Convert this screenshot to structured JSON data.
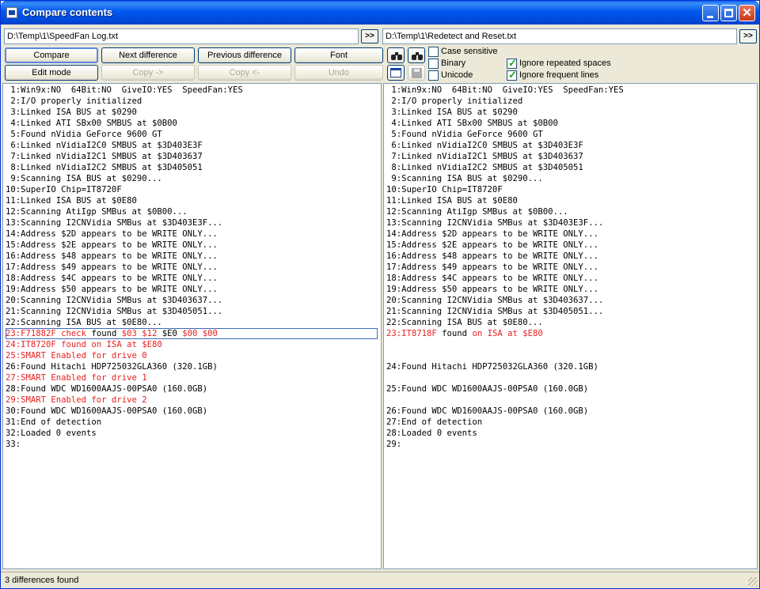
{
  "window": {
    "title": "Compare contents",
    "close_glyph": "✕"
  },
  "files": {
    "left_path": "D:\\Temp\\1\\SpeedFan Log.txt",
    "right_path": "D:\\Temp\\1\\Redetect and Reset.txt",
    "browse_label": ">>"
  },
  "toolbar": {
    "compare": "Compare",
    "next_difference": "Next difference",
    "previous_difference": "Previous difference",
    "font": "Font",
    "edit_mode": "Edit mode",
    "copy_right": "Copy ->",
    "copy_left": "Copy <-",
    "undo": "Undo"
  },
  "options": {
    "case_sensitive": {
      "label": "Case sensitive",
      "checked": false
    },
    "binary": {
      "label": "Binary",
      "checked": false
    },
    "unicode": {
      "label": "Unicode",
      "checked": false
    },
    "ignore_repeated_spaces": {
      "label": "Ignore repeated spaces",
      "checked": true
    },
    "ignore_frequent_lines": {
      "label": "Ignore frequent lines",
      "checked": true
    }
  },
  "icons": {
    "find": "binoculars-icon",
    "find_next": "binoculars-icon",
    "window": "window-icon",
    "save": "save-icon"
  },
  "colors": {
    "difference": "#e82020",
    "focus_outline": "#3c6bba"
  },
  "left_lines": [
    [
      {
        "t": " 1:Win9x:NO  64Bit:NO  GiveIO:YES  SpeedFan:YES"
      }
    ],
    [
      {
        "t": " 2:I/O properly initialized"
      }
    ],
    [
      {
        "t": " 3:Linked ISA BUS at $0290"
      }
    ],
    [
      {
        "t": " 4:Linked ATI SBx00 SMBUS at $0B00"
      }
    ],
    [
      {
        "t": " 5:Found nVidia GeForce 9600 GT"
      }
    ],
    [
      {
        "t": " 6:Linked nVidiaI2C0 SMBUS at $3D403E3F"
      }
    ],
    [
      {
        "t": " 7:Linked nVidiaI2C1 SMBUS at $3D403637"
      }
    ],
    [
      {
        "t": " 8:Linked nVidiaI2C2 SMBUS at $3D405051"
      }
    ],
    [
      {
        "t": " 9:Scanning ISA BUS at $0290..."
      }
    ],
    [
      {
        "t": "10:SuperIO Chip=IT8720F"
      }
    ],
    [
      {
        "t": "11:Linked ISA BUS at $0E80"
      }
    ],
    [
      {
        "t": "12:Scanning AtiIgp SMBus at $0B00..."
      }
    ],
    [
      {
        "t": "13:Scanning I2CNVidia SMBus at $3D403E3F..."
      }
    ],
    [
      {
        "t": "14:Address $2D appears to be WRITE ONLY..."
      }
    ],
    [
      {
        "t": "15:Address $2E appears to be WRITE ONLY..."
      }
    ],
    [
      {
        "t": "16:Address $48 appears to be WRITE ONLY..."
      }
    ],
    [
      {
        "t": "17:Address $49 appears to be WRITE ONLY..."
      }
    ],
    [
      {
        "t": "18:Address $4C appears to be WRITE ONLY..."
      }
    ],
    [
      {
        "t": "19:Address $50 appears to be WRITE ONLY..."
      }
    ],
    [
      {
        "t": "20:Scanning I2CNVidia SMBus at $3D403637..."
      }
    ],
    [
      {
        "t": "21:Scanning I2CNVidia SMBus at $3D405051..."
      }
    ],
    [
      {
        "t": "22:Scanning ISA BUS at $0E80..."
      }
    ],
    [
      {
        "t": "23:F71882F check",
        "d": true
      },
      {
        "t": " found "
      },
      {
        "t": "$03 $12",
        "d": true
      },
      {
        "t": " $E0 "
      },
      {
        "t": "$00 $00",
        "d": true
      }
    ],
    [
      {
        "t": "24:IT8720F found on ISA at $E80",
        "d": true
      }
    ],
    [
      {
        "t": "25:SMART Enabled for drive 0",
        "d": true
      }
    ],
    [
      {
        "t": "26:Found Hitachi HDP725032GLA360 (320.1GB)"
      }
    ],
    [
      {
        "t": "27:SMART Enabled for drive 1",
        "d": true
      }
    ],
    [
      {
        "t": "28:Found WDC WD1600AAJS-00PSA0 (160.0GB)"
      }
    ],
    [
      {
        "t": "29:SMART Enabled for drive 2",
        "d": true
      }
    ],
    [
      {
        "t": "30:Found WDC WD1600AAJS-00PSA0 (160.0GB)"
      }
    ],
    [
      {
        "t": "31:End of detection"
      }
    ],
    [
      {
        "t": "32:Loaded 0 events"
      }
    ],
    [
      {
        "t": "33:"
      }
    ]
  ],
  "right_lines": [
    [
      {
        "t": " 1:Win9x:NO  64Bit:NO  GiveIO:YES  SpeedFan:YES"
      }
    ],
    [
      {
        "t": " 2:I/O properly initialized"
      }
    ],
    [
      {
        "t": " 3:Linked ISA BUS at $0290"
      }
    ],
    [
      {
        "t": " 4:Linked ATI SBx00 SMBUS at $0B00"
      }
    ],
    [
      {
        "t": " 5:Found nVidia GeForce 9600 GT"
      }
    ],
    [
      {
        "t": " 6:Linked nVidiaI2C0 SMBUS at $3D403E3F"
      }
    ],
    [
      {
        "t": " 7:Linked nVidiaI2C1 SMBUS at $3D403637"
      }
    ],
    [
      {
        "t": " 8:Linked nVidiaI2C2 SMBUS at $3D405051"
      }
    ],
    [
      {
        "t": " 9:Scanning ISA BUS at $0290..."
      }
    ],
    [
      {
        "t": "10:SuperIO Chip=IT8720F"
      }
    ],
    [
      {
        "t": "11:Linked ISA BUS at $0E80"
      }
    ],
    [
      {
        "t": "12:Scanning AtiIgp SMBus at $0B00..."
      }
    ],
    [
      {
        "t": "13:Scanning I2CNVidia SMBus at $3D403E3F..."
      }
    ],
    [
      {
        "t": "14:Address $2D appears to be WRITE ONLY..."
      }
    ],
    [
      {
        "t": "15:Address $2E appears to be WRITE ONLY..."
      }
    ],
    [
      {
        "t": "16:Address $48 appears to be WRITE ONLY..."
      }
    ],
    [
      {
        "t": "17:Address $49 appears to be WRITE ONLY..."
      }
    ],
    [
      {
        "t": "18:Address $4C appears to be WRITE ONLY..."
      }
    ],
    [
      {
        "t": "19:Address $50 appears to be WRITE ONLY..."
      }
    ],
    [
      {
        "t": "20:Scanning I2CNVidia SMBus at $3D403637..."
      }
    ],
    [
      {
        "t": "21:Scanning I2CNVidia SMBus at $3D405051..."
      }
    ],
    [
      {
        "t": "22:Scanning ISA BUS at $0E80..."
      }
    ],
    [
      {
        "t": "23:IT8718F",
        "d": true
      },
      {
        "t": " found "
      },
      {
        "t": "on ISA at $E80",
        "d": true
      }
    ],
    [],
    [],
    [
      {
        "t": "24:Found Hitachi HDP725032GLA360 (320.1GB)"
      }
    ],
    [],
    [
      {
        "t": "25:Found WDC WD1600AAJS-00PSA0 (160.0GB)"
      }
    ],
    [],
    [
      {
        "t": "26:Found WDC WD1600AAJS-00PSA0 (160.0GB)"
      }
    ],
    [
      {
        "t": "27:End of detection"
      }
    ],
    [
      {
        "t": "28:Loaded 0 events"
      }
    ],
    [
      {
        "t": "29:"
      }
    ]
  ],
  "focused_line_index": 22,
  "status": {
    "text": "3 differences found"
  }
}
